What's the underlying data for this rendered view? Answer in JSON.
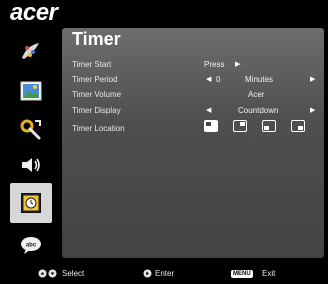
{
  "brand": {
    "logo": "acer"
  },
  "sidebar": {
    "items": [
      {
        "icon": "image-adjust-icon"
      },
      {
        "icon": "picture-icon"
      },
      {
        "icon": "settings-wrench-icon"
      },
      {
        "icon": "speaker-icon"
      },
      {
        "icon": "timer-icon",
        "selected": true
      },
      {
        "icon": "language-speech-icon"
      }
    ]
  },
  "panel": {
    "title": "Timer",
    "rows": [
      {
        "label": "Timer Start",
        "value": "Press"
      },
      {
        "label": "Timer Period",
        "number": "0",
        "unit": "Minutes"
      },
      {
        "label": "Timer Volume",
        "value": "Acer"
      },
      {
        "label": "Timer Display",
        "value": "Countdown"
      },
      {
        "label": "Timer Location",
        "selected_location": "top-left"
      }
    ]
  },
  "footer": {
    "select": "Select",
    "enter": "Enter",
    "menu_key": "MENU",
    "exit": "Exit"
  },
  "colors": {
    "panel": "#555555",
    "selected_sidebar": "#d7d7d7",
    "accent_timer": "#f2c230"
  }
}
